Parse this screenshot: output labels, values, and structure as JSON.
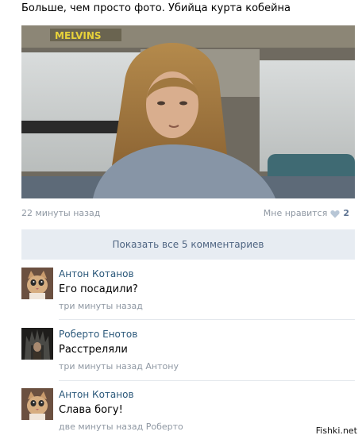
{
  "post": {
    "text": "Больше, чем просто фото. Убийца курта кобейна",
    "time": "22 минуты назад",
    "like_label": "Мне нравится",
    "like_count": "2",
    "photo_sign": "MELVINS"
  },
  "comments_block": {
    "show_all_label": "Показать все 5 комментариев"
  },
  "comments": [
    {
      "author": "Антон Котанов",
      "text": "Его посадили?",
      "date": "три минуты назад",
      "reply_to": "",
      "avatar": "cat-avatar"
    },
    {
      "author": "Роберто Енотов",
      "text": "Расстреляли",
      "date": "три минуты назад",
      "reply_to": "Антону",
      "avatar": "throne-avatar"
    },
    {
      "author": "Антон Котанов",
      "text": "Слава богу!",
      "date": "две минуты назад",
      "reply_to": "Роберто",
      "avatar": "cat-avatar"
    }
  ],
  "watermark": "Fishki.net",
  "colors": {
    "link": "#2b587a",
    "muted": "#8f98a3",
    "button_bg": "#e7ecf2",
    "button_text": "#4f6582"
  }
}
